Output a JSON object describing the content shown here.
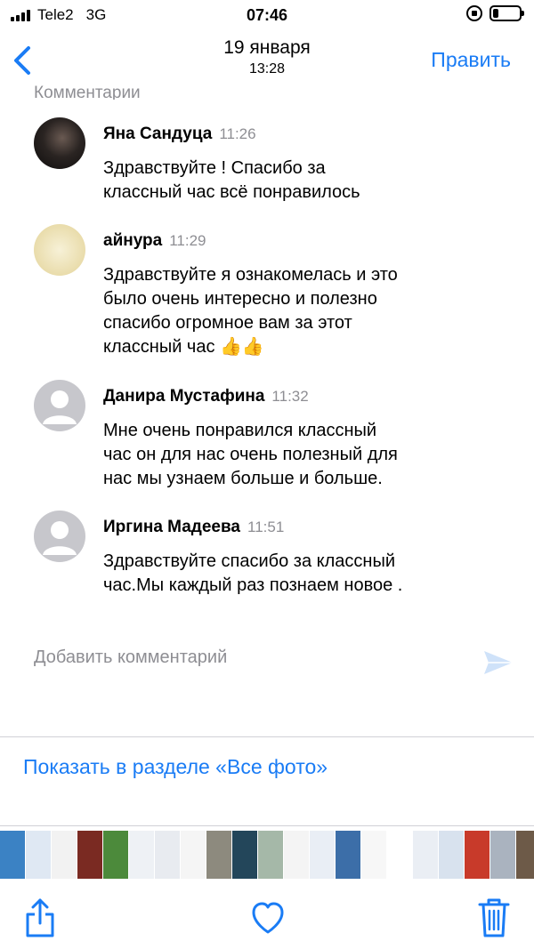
{
  "status_bar": {
    "carrier": "Tele2",
    "network": "3G",
    "time": "07:46",
    "battery_level": 0.2
  },
  "nav": {
    "date": "19 января",
    "time": "13:28",
    "edit_label": "Править",
    "back_icon": "chevron-left-icon",
    "accent_color": "#1a7cf5"
  },
  "comments_header": "Комментарии",
  "comments": [
    {
      "author": "Яна Сандуца",
      "time": "11:26",
      "lines": [
        "Здравствуйте ! Спасибо за",
        "классный час всё понравилось"
      ]
    },
    {
      "author": "айнура",
      "time": "11:29",
      "lines": [
        "Здравствуйте я ознакомелась и это",
        "было очень интересно и полезно",
        "спасибо огромное вам за этот",
        "классный час 👍👍"
      ]
    },
    {
      "author": "Данира Мустафина",
      "time": "11:32",
      "lines": [
        "Мне очень понравился  классный",
        "час он для нас очень полезный для",
        "нас мы узнаем  больше и больше."
      ]
    },
    {
      "author": "Иргина Мадеева",
      "time": "11:51",
      "lines": [
        "Здравствуйте спасибо за классный",
        "час.Мы каждый раз познаем новое ."
      ]
    }
  ],
  "add_comment": {
    "placeholder": "Добавить комментарий",
    "send_icon": "send-icon"
  },
  "show_all_label": "Показать в разделе «Все фото»",
  "thumbnails_colors": [
    "#3b82c4",
    "#dfe8f3",
    "#f2f2f2",
    "#7a2a22",
    "#4c8a3b",
    "#eef1f5",
    "#e8ebf0",
    "#f5f5f5",
    "#8d8a7e",
    "#23465a",
    "#a5b8a8",
    "#f4f4f4",
    "#e9eef5",
    "#3c6ea8",
    "#f7f7f7",
    "#ffffff",
    "#eaeef4",
    "#d8e2ee",
    "#c83a2a",
    "#aab3bf",
    "#6d5a48",
    "#b48a5a",
    "#d6c4a2",
    "#5a4e44",
    "#f1f1f1",
    "#e6e6e6",
    "#9a9a92",
    "#dde6ef",
    "#eff2f6",
    "#4e9a5e",
    "#f0f3f7",
    "#c8d4e0"
  ],
  "toolbar": {
    "share_icon": "share-icon",
    "favorite_icon": "heart-icon",
    "delete_icon": "trash-icon"
  }
}
